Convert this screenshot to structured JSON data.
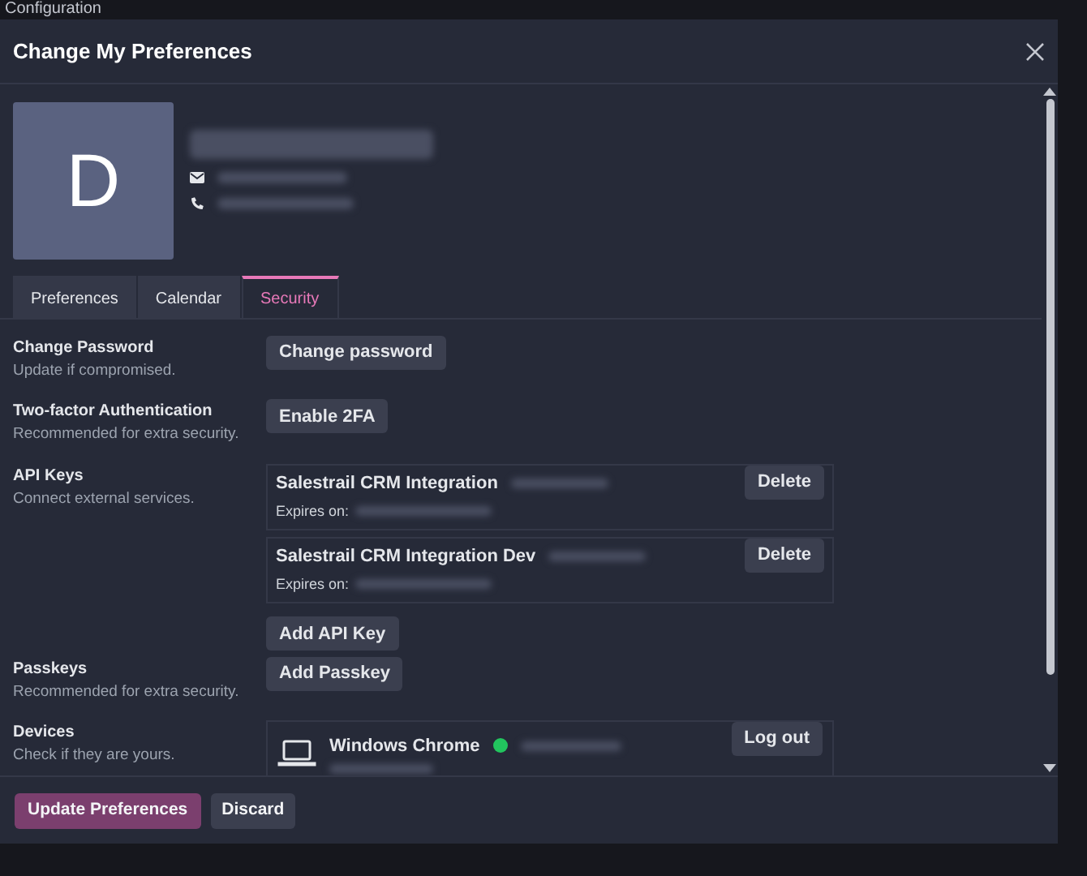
{
  "page": {
    "title": "Configuration"
  },
  "dialog": {
    "title": "Change My Preferences",
    "avatar_letter": "D"
  },
  "tabs": [
    {
      "label": "Preferences",
      "selected": false
    },
    {
      "label": "Calendar",
      "selected": false
    },
    {
      "label": "Security",
      "selected": true
    }
  ],
  "sections": [
    {
      "kind": "button",
      "title": "Change Password",
      "description": "Update if compromised.",
      "button": "Change password"
    },
    {
      "kind": "button",
      "title": "Two-factor Authentication",
      "description": "Recommended for extra security.",
      "button": "Enable 2FA"
    },
    {
      "kind": "api_keys",
      "title": "API Keys",
      "description": "Connect external services.",
      "keys": [
        {
          "name": "Salestrail CRM Integration",
          "expires_label": "Expires on:",
          "action": "Delete"
        },
        {
          "name": "Salestrail CRM Integration Dev",
          "expires_label": "Expires on:",
          "action": "Delete"
        }
      ],
      "button": "Add API Key"
    },
    {
      "kind": "button",
      "title": "Passkeys",
      "description": "Recommended for extra security.",
      "button": "Add Passkey"
    },
    {
      "kind": "devices",
      "title": "Devices",
      "description": "Check if they are yours.",
      "devices": [
        {
          "name": "Windows Chrome",
          "color": "#22c55e",
          "action": "Log out"
        }
      ]
    }
  ],
  "footer": {
    "primary": "Update Preferences",
    "secondary": "Discard"
  }
}
